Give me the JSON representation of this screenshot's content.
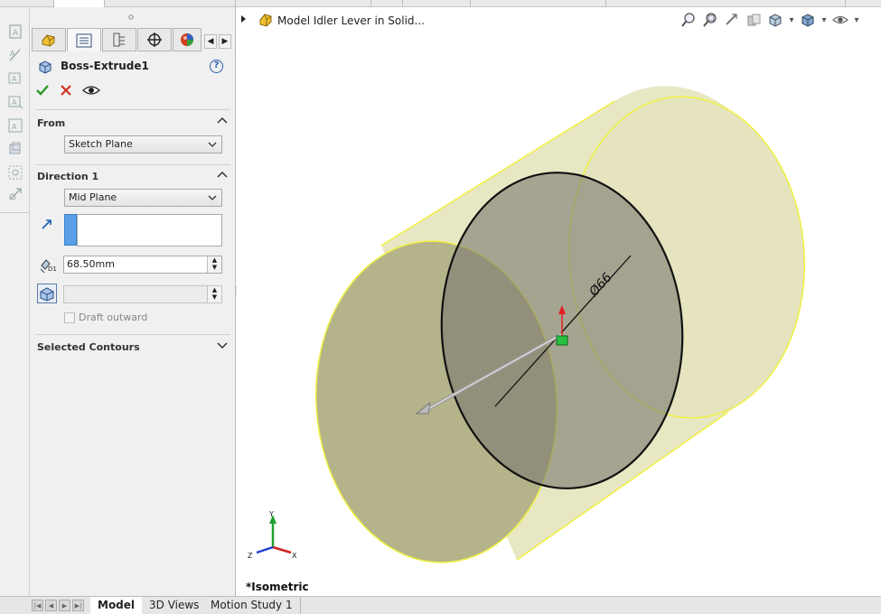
{
  "document": {
    "title": "Model Idler Lever in Solid..."
  },
  "feature": {
    "name": "Boss-Extrude1",
    "help": "?"
  },
  "sections": {
    "from": {
      "title": "From",
      "value": "Sketch Plane"
    },
    "direction1": {
      "title": "Direction 1",
      "end_condition": "Mid Plane",
      "depth": "68.50mm",
      "depth_icon_label": "D1",
      "draft_outward": "Draft outward"
    },
    "selected_contours": {
      "title": "Selected Contours"
    }
  },
  "viewport": {
    "view_label": "*Isometric",
    "dimension": "Ø66",
    "triad": {
      "x": "X",
      "y": "Y",
      "z": "Z"
    }
  },
  "bottom_tabs": [
    {
      "label": "Model"
    },
    {
      "label": "3D Views"
    },
    {
      "label": "Motion Study 1"
    }
  ],
  "colors": {
    "accept": "#2a9a2a",
    "cancel": "#d03020",
    "body_fill": "#c9c898",
    "body_edge": "#f0f040"
  }
}
